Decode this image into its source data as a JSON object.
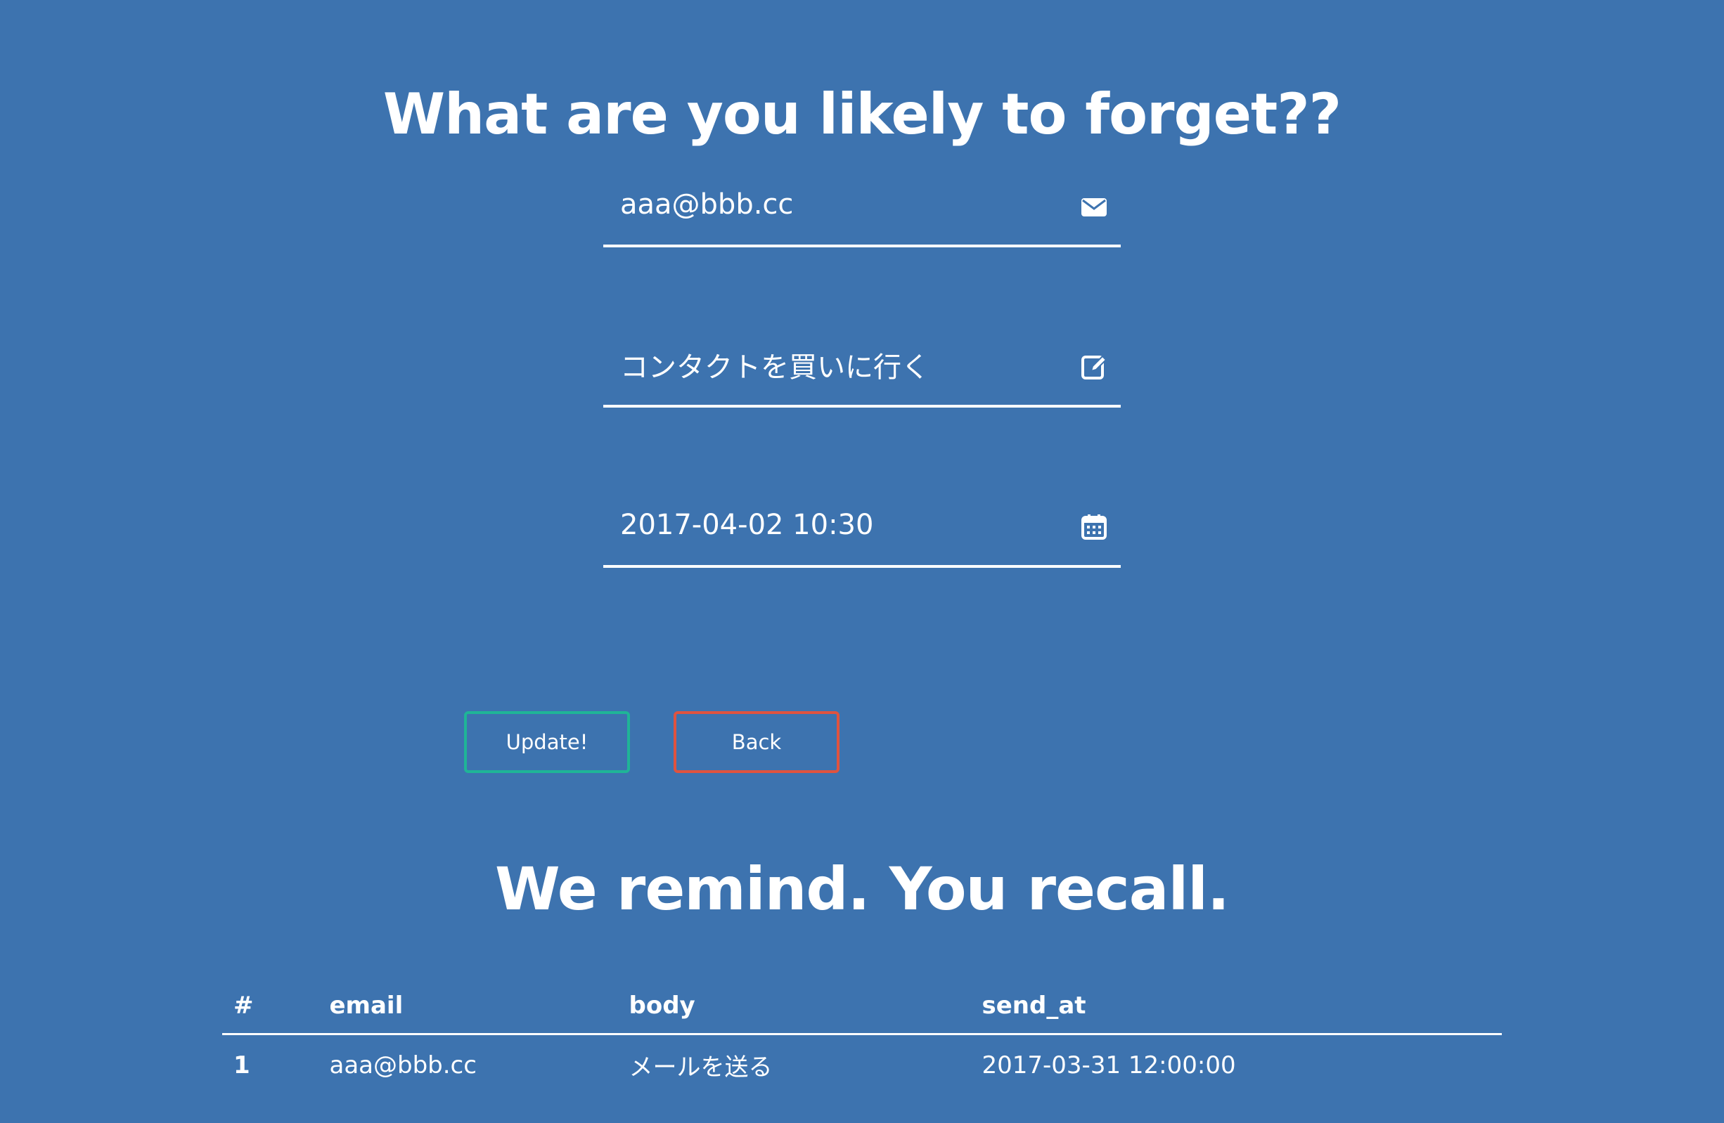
{
  "page_title": "What are you likely to forget??",
  "form": {
    "email_value": "aaa@bbb.cc",
    "email_icon": "envelope-icon",
    "body_value": "コンタクトを買いに行く",
    "body_icon": "edit-icon",
    "send_at_value": "2017-04-02 10:30",
    "send_at_icon": "calendar-icon"
  },
  "buttons": {
    "update_label": "Update!",
    "back_label": "Back"
  },
  "section_title": "We remind. You recall.",
  "table": {
    "headers": {
      "num": "#",
      "email": "email",
      "body": "body",
      "send_at": "send_at"
    },
    "rows": [
      {
        "num": "1",
        "email": "aaa@bbb.cc",
        "body": "メールを送る",
        "send_at": "2017-03-31 12:00:00"
      }
    ]
  },
  "colors": {
    "background": "#3d73af",
    "update_border": "#1fb597",
    "back_border": "#e0533f"
  }
}
